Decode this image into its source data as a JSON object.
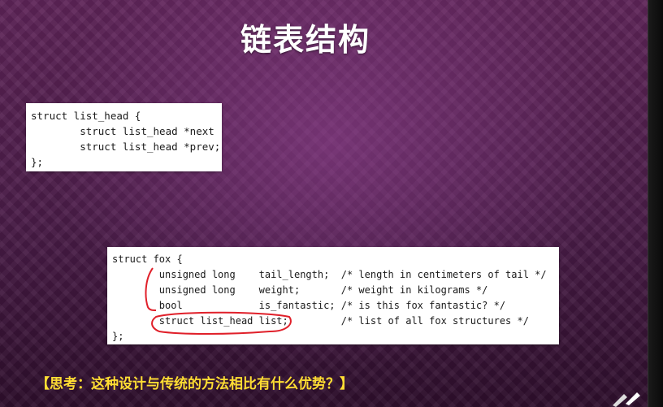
{
  "slide": {
    "title": "链表结构",
    "code_block_1": [
      "struct list_head {",
      "        struct list_head *next",
      "        struct list_head *prev;",
      "};"
    ],
    "code_block_2": [
      "struct fox {",
      "        unsigned long    tail_length;  /* length in centimeters of tail */",
      "        unsigned long    weight;       /* weight in kilograms */",
      "        bool             is_fantastic; /* is this fox fantastic? */",
      "        struct list_head list;         /* list of all fox structures */",
      "};"
    ],
    "question": "【思考：这种设计与传统的方法相比有什么优势？】"
  },
  "colors": {
    "background": "#4a1c48",
    "title_text": "#ffffff",
    "question_text": "#ffdd33",
    "annotation_ink": "#e0202a"
  },
  "icons": [
    "pen-annotation-icon"
  ]
}
